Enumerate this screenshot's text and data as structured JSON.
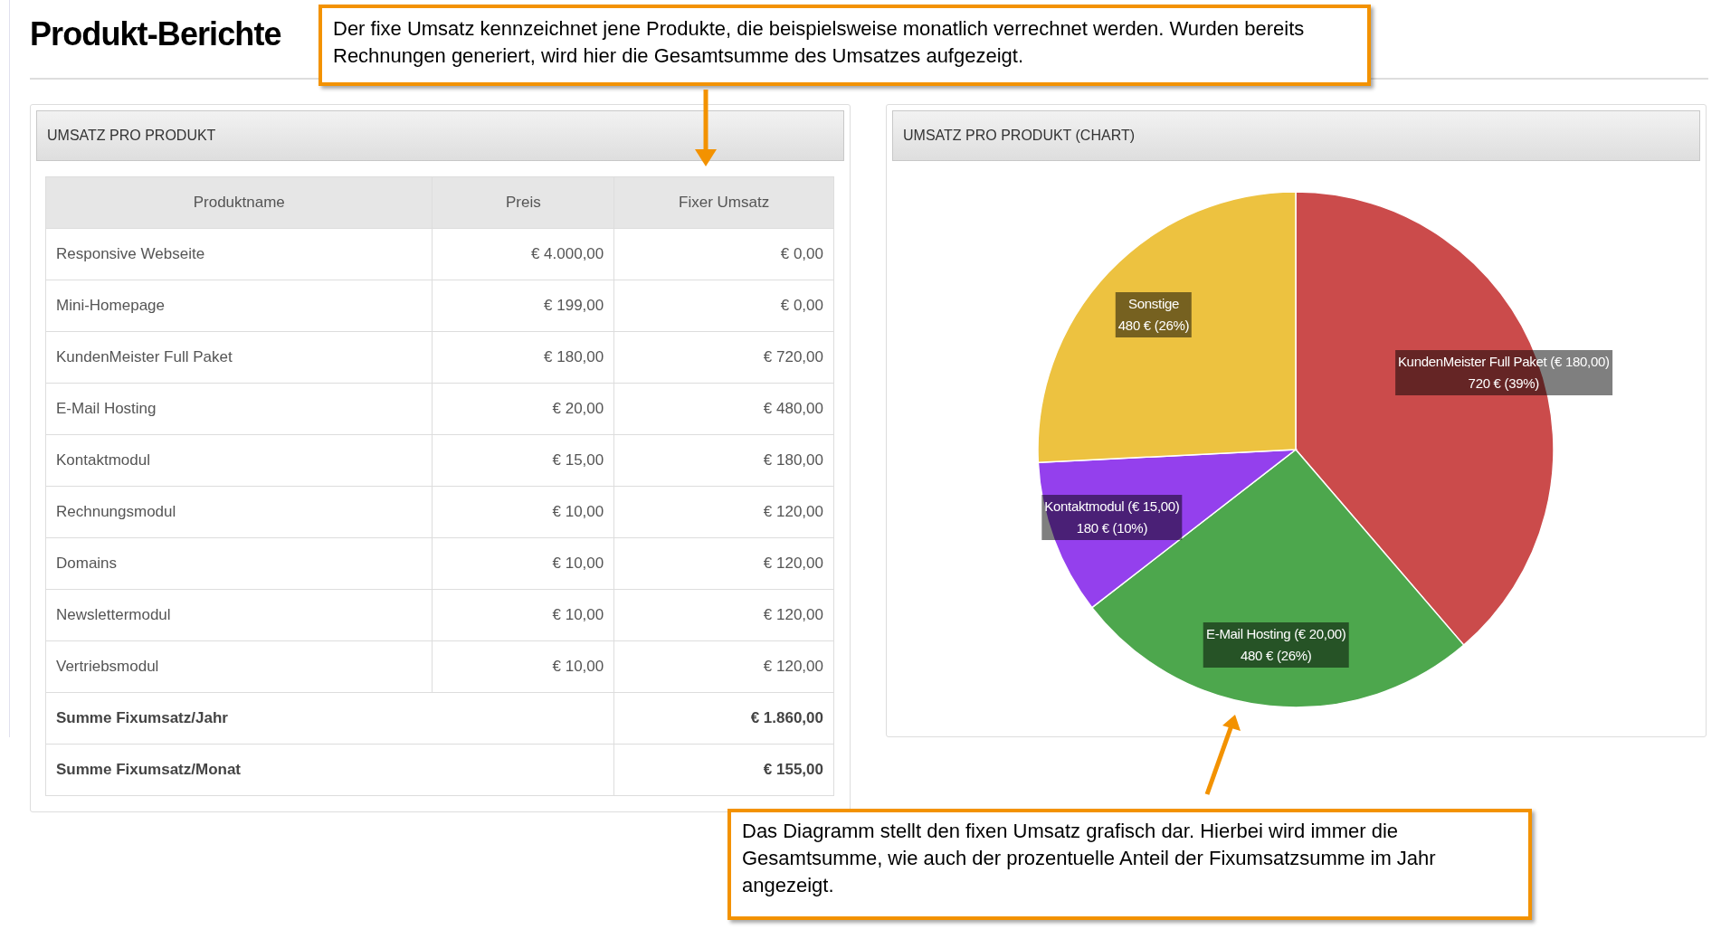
{
  "page": {
    "title": "Produkt-Berichte"
  },
  "callouts": [
    {
      "text": "Der fixe Umsatz kennzeichnet jene Produkte, die beispielsweise monatlich verrechnet werden. Wurden bereits Rechnungen generiert, wird hier die Gesamtsumme des Umsatzes aufgezeigt."
    },
    {
      "text": "Das Diagramm stellt den fixen Umsatz grafisch dar. Hierbei wird immer die Gesamtsumme, wie auch der prozentuelle Anteil der Fixumsatzsumme im Jahr angezeigt."
    }
  ],
  "table_panel": {
    "title": "UMSATZ PRO PRODUKT",
    "columns": [
      "Produktname",
      "Preis",
      "Fixer Umsatz"
    ],
    "rows": [
      {
        "cells": [
          "Responsive Webseite",
          "€ 4.000,00",
          "€ 0,00"
        ]
      },
      {
        "cells": [
          "Mini-Homepage",
          "€ 199,00",
          "€ 0,00"
        ]
      },
      {
        "cells": [
          "KundenMeister Full Paket",
          "€ 180,00",
          "€ 720,00"
        ]
      },
      {
        "cells": [
          "E-Mail Hosting",
          "€ 20,00",
          "€ 480,00"
        ]
      },
      {
        "cells": [
          "Kontaktmodul",
          "€ 15,00",
          "€ 180,00"
        ]
      },
      {
        "cells": [
          "Rechnungsmodul",
          "€ 10,00",
          "€ 120,00"
        ]
      },
      {
        "cells": [
          "Domains",
          "€ 10,00",
          "€ 120,00"
        ]
      },
      {
        "cells": [
          "Newslettermodul",
          "€ 10,00",
          "€ 120,00"
        ]
      },
      {
        "cells": [
          "Vertriebsmodul",
          "€ 10,00",
          "€ 120,00"
        ]
      }
    ],
    "totals": [
      {
        "label": "Summe Fixumsatz/Jahr",
        "value": "€ 1.860,00"
      },
      {
        "label": "Summe Fixumsatz/Monat",
        "value": "€ 155,00"
      }
    ]
  },
  "chart_panel": {
    "title": "UMSATZ PRO PRODUKT (CHART)",
    "chart_data": {
      "type": "pie",
      "categories": [
        "KundenMeister Full Paket (€ 180,00)",
        "E-Mail Hosting (€ 20,00)",
        "Kontaktmodul (€ 15,00)",
        "Sonstige"
      ],
      "values": [
        38.7,
        25.8,
        9.7,
        25.8
      ],
      "colors": [
        "#cb4b4b",
        "#4da74d",
        "#9440ed",
        "#edc240"
      ],
      "value_labels": [
        "720 € (39%)",
        "480 € (26%)",
        "180 € (10%)",
        "480 € (26%)"
      ]
    }
  }
}
